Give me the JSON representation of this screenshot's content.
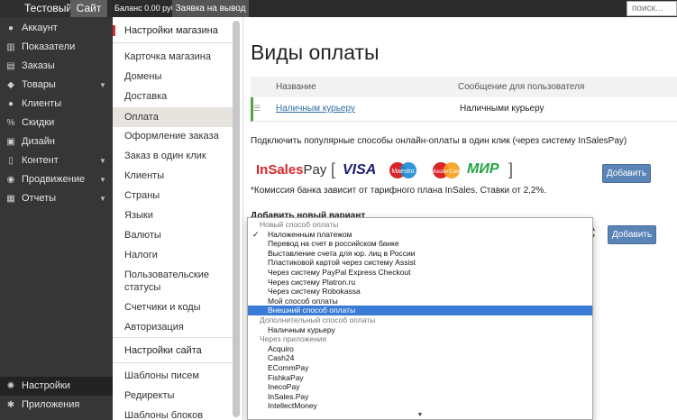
{
  "topbar": {
    "brand": "Тестовый",
    "site": "Сайт",
    "balance": "Баланс 0.00 руб",
    "withdraw": "Заявка на вывод",
    "search_placeholder": "поиск..."
  },
  "leftnav": {
    "items": [
      {
        "label": "Аккаунт",
        "icon": "person-icon",
        "chevron": false
      },
      {
        "label": "Показатели",
        "icon": "chart-icon",
        "chevron": false
      },
      {
        "label": "Заказы",
        "icon": "cart-icon",
        "chevron": false
      },
      {
        "label": "Товары",
        "icon": "tag-icon",
        "chevron": true
      },
      {
        "label": "Клиенты",
        "icon": "users-icon",
        "chevron": false
      },
      {
        "label": "Скидки",
        "icon": "percent-icon",
        "chevron": false
      },
      {
        "label": "Дизайн",
        "icon": "image-icon",
        "chevron": false
      },
      {
        "label": "Контент",
        "icon": "doc-icon",
        "chevron": true
      },
      {
        "label": "Продвижение",
        "icon": "promo-icon",
        "chevron": true
      },
      {
        "label": "Отчеты",
        "icon": "report-icon",
        "chevron": true
      }
    ],
    "bottom": [
      {
        "label": "Настройки",
        "icon": "gear-icon"
      },
      {
        "label": "Приложения",
        "icon": "apps-icon"
      }
    ]
  },
  "settings": {
    "header_store": "Настройки магазина",
    "store_items": [
      "Карточка магазина",
      "Домены",
      "Доставка",
      "Оплата",
      "Оформление заказа",
      "Заказ в один клик",
      "Клиенты",
      "Страны",
      "Языки",
      "Валюты",
      "Налоги",
      "Пользовательские статусы",
      "Счетчики и коды",
      "Авторизация"
    ],
    "header_site": "Настройки сайта",
    "site_items": [
      "Шаблоны писем",
      "Редиректы",
      "Шаблоны блоков"
    ]
  },
  "main": {
    "title": "Виды оплаты",
    "table": {
      "col_name": "Название",
      "col_msg": "Сообщение для пользователя",
      "row_name": "Наличным курьеру",
      "row_msg": "Наличными курьеру"
    },
    "connect_text": "Подключить популярные способы онлайн-оплаты в один клик (через систему InSalesPay)",
    "logos": {
      "insales": "InSales",
      "pay": "Pay",
      "visa": "VISA",
      "maestro": "Maestro",
      "mastercard": "MasterCard",
      "mir": "МИР"
    },
    "add_label": "Добавить",
    "commission": "*Комиссия банка зависит от тарифного плана InSales. Ставки от 2,2%.",
    "add_variant_label": "Добавить новый вариант",
    "add_label2": "Добавить"
  },
  "dropdown": {
    "rows": [
      {
        "text": "Новый способ оплаты",
        "type": "group"
      },
      {
        "text": "Наложенным платежом",
        "type": "opt",
        "checked": true
      },
      {
        "text": "Перевод на счет в российском банке",
        "type": "opt"
      },
      {
        "text": "Выставление счета для юр. лиц в России",
        "type": "opt"
      },
      {
        "text": "Пластиковой картой через систему Assist",
        "type": "opt"
      },
      {
        "text": "Через систему PayPal Express Checkout",
        "type": "opt"
      },
      {
        "text": "Через систему Platron.ru",
        "type": "opt"
      },
      {
        "text": "Через систему Robokassa",
        "type": "opt"
      },
      {
        "text": "Мой способ оплаты",
        "type": "opt"
      },
      {
        "text": "Внешний способ оплаты",
        "type": "opt",
        "highlight": true
      },
      {
        "text": "Дополнительный способ оплаты",
        "type": "group"
      },
      {
        "text": "Наличным курьеру",
        "type": "opt"
      },
      {
        "text": "Через приложения",
        "type": "group"
      },
      {
        "text": "Acquiro",
        "type": "opt"
      },
      {
        "text": "Cash24",
        "type": "opt"
      },
      {
        "text": "ECommPay",
        "type": "opt"
      },
      {
        "text": "FishkaPay",
        "type": "opt"
      },
      {
        "text": "InecoPay",
        "type": "opt"
      },
      {
        "text": "InSales.Pay",
        "type": "opt"
      },
      {
        "text": "IntellectMoney",
        "type": "opt"
      }
    ]
  }
}
